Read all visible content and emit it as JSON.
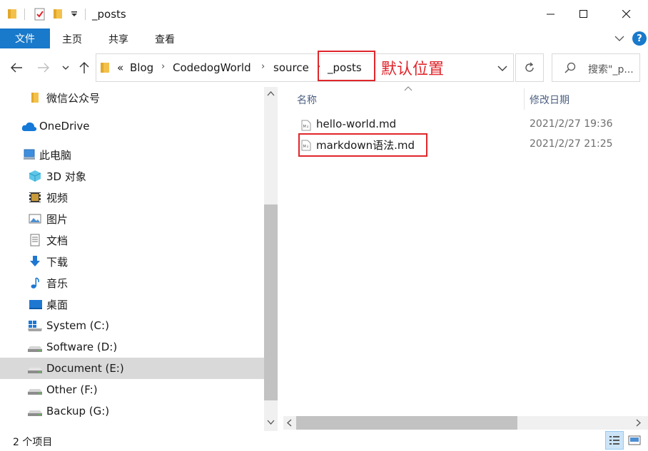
{
  "window": {
    "title": "_posts",
    "controls": {
      "minimize": "minimize-icon",
      "maximize": "maximize-icon",
      "close": "close-icon"
    }
  },
  "ribbon": {
    "tabs": [
      {
        "label": "文件",
        "active": true
      },
      {
        "label": "主页"
      },
      {
        "label": "共享"
      },
      {
        "label": "查看"
      }
    ]
  },
  "address": {
    "overflow": "«",
    "crumbs": [
      "Blog",
      "CodedogWorld",
      "source",
      "_posts"
    ],
    "annotation": "默认位置",
    "search_placeholder": "搜索\"_p..."
  },
  "sidebar": {
    "items": [
      {
        "label": "微信公众号",
        "icon": "folder-icon"
      },
      {
        "label": "OneDrive",
        "icon": "cloud-icon"
      },
      {
        "label": "此电脑",
        "icon": "computer-icon"
      },
      {
        "label": "3D 对象",
        "icon": "cube-icon"
      },
      {
        "label": "视频",
        "icon": "video-icon"
      },
      {
        "label": "图片",
        "icon": "picture-icon"
      },
      {
        "label": "文档",
        "icon": "document-icon"
      },
      {
        "label": "下载",
        "icon": "download-icon"
      },
      {
        "label": "音乐",
        "icon": "music-icon"
      },
      {
        "label": "桌面",
        "icon": "desktop-icon"
      },
      {
        "label": "System (C:)",
        "icon": "windows-drive-icon"
      },
      {
        "label": "Software (D:)",
        "icon": "drive-icon"
      },
      {
        "label": "Document (E:)",
        "icon": "drive-icon",
        "selected": true
      },
      {
        "label": "Other (F:)",
        "icon": "drive-icon"
      },
      {
        "label": "Backup (G:)",
        "icon": "drive-icon"
      }
    ]
  },
  "content": {
    "columns": {
      "name": "名称",
      "modified": "修改日期"
    },
    "files": [
      {
        "name": "hello-world.md",
        "modified": "2021/2/27 19:36"
      },
      {
        "name": "markdown语法.md",
        "modified": "2021/2/27 21:25",
        "highlighted": true
      }
    ]
  },
  "status": {
    "item_count": "2 个项目"
  },
  "colors": {
    "accent": "#1979ca",
    "annotation_red": "#e0262b",
    "selected_bg": "#d9d9d9"
  }
}
